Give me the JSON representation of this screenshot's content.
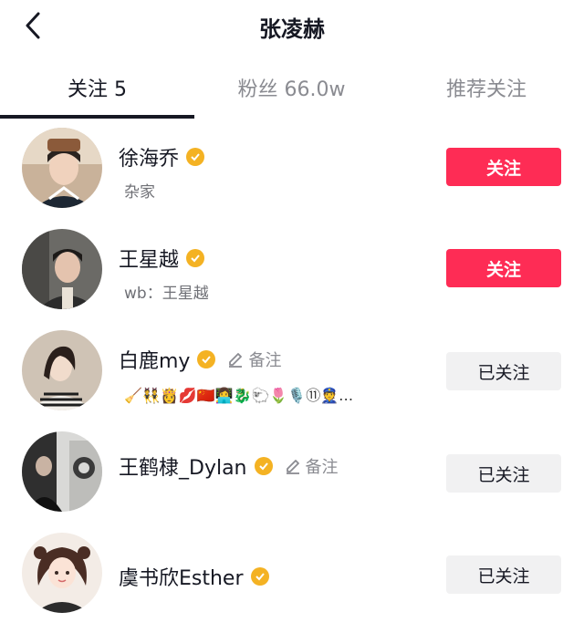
{
  "header": {
    "title": "张凌赫",
    "back_icon": "chevron-left-icon"
  },
  "tabs": [
    {
      "label": "关注 5",
      "active": true
    },
    {
      "label": "粉丝 66.0w",
      "active": false
    },
    {
      "label": "推荐关注",
      "active": false
    }
  ],
  "colors": {
    "accent_follow": "#fe2c55",
    "following_bg": "#f1f1f2",
    "verified_badge": "#f4b223"
  },
  "users": [
    {
      "name": "徐海乔",
      "verified": true,
      "subtitle": "杂家",
      "button_label": "关注",
      "button_state": "follow"
    },
    {
      "name": "王星越",
      "verified": true,
      "subtitle": "wb：王星越",
      "button_label": "关注",
      "button_state": "follow"
    },
    {
      "name": "白鹿my",
      "verified": true,
      "remark_label": "备注",
      "subtitle": "🧹👯👸💋🇨🇳👩‍💻🐉🐑🌷🎙️⑪👮…",
      "button_label": "已关注",
      "button_state": "following"
    },
    {
      "name": "王鹤棣_Dylan",
      "verified": true,
      "remark_label": "备注",
      "button_label": "已关注",
      "button_state": "following"
    },
    {
      "name": "虞书欣Esther",
      "verified": true,
      "button_label": "已关注",
      "button_state": "following"
    }
  ]
}
